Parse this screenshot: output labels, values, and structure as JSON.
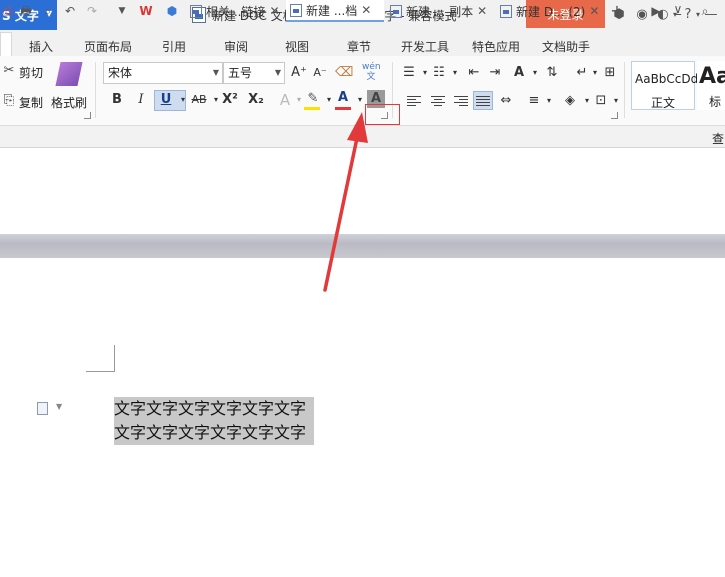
{
  "titlebar": {
    "app_label": "S 文字",
    "doc_title": "新建 DOC 文档.doc * - WPS 文字 - 兼容模式",
    "login_label": "未登录"
  },
  "ribbon_tabs": [
    "插入",
    "页面布局",
    "引用",
    "审阅",
    "视图",
    "章节",
    "开发工具",
    "特色应用",
    "文档助手"
  ],
  "clipboard": {
    "cut": "剪切",
    "copy": "复制",
    "format_painter": "格式刷"
  },
  "font": {
    "name": "宋体",
    "size": "五号",
    "bold": "B",
    "italic": "I",
    "underline": "U",
    "strike": "AB",
    "superscript": "X²",
    "subscript": "X₂",
    "font_color_letter": "A",
    "char_shading_letter": "A",
    "grow": "A⁺",
    "shrink": "A⁻",
    "phonetic": "wén 文"
  },
  "styles": {
    "normal_preview": "AaBbCcDd",
    "normal_label": "正文",
    "title_preview": "Aa",
    "title_label": "标"
  },
  "doc_tabs": [
    {
      "label": "相关...链接"
    },
    {
      "label": "新建 ...档"
    },
    {
      "label": "新建 ... 副本"
    },
    {
      "label": "新建 D... (2)"
    }
  ],
  "search_label": "查",
  "document": {
    "lines": [
      "文字文字文字文字文字文字",
      "文字文字文字文字文字文字"
    ]
  },
  "colors": {
    "app_button": "#2b6fd6",
    "login_button": "#e8694a",
    "annotation": "#e23a3a",
    "selection": "#c8c8c8"
  }
}
